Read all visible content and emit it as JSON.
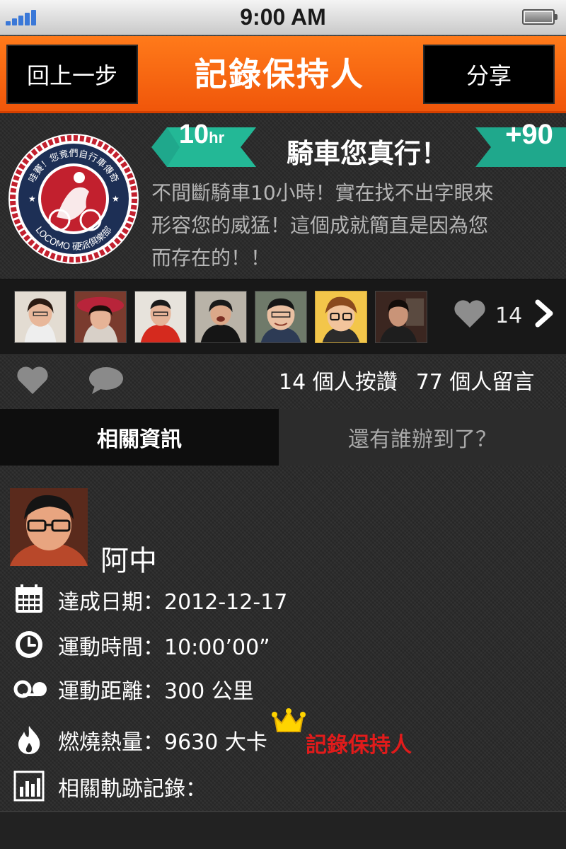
{
  "status_bar": {
    "time": "9:00 AM"
  },
  "header": {
    "back_label": "回上一步",
    "title": "記錄保持人",
    "share_label": "分享"
  },
  "achievement": {
    "badge_text_top": "哇賽！您竟們自行車傳奇",
    "badge_text_bottom": "LOCOMO 硬派俱樂部",
    "hours_value": "10",
    "hours_unit": "hr",
    "title": "騎車您真行！",
    "bonus": "+90",
    "description_lines": [
      "不間斷騎車10小時！實在找不出字眼來",
      "形容您的威猛！這個成就簡直是因為您",
      "而存在的！！"
    ]
  },
  "likers": {
    "count": "14",
    "avatars": [
      "avatar-1",
      "avatar-2",
      "avatar-3",
      "avatar-4",
      "avatar-5",
      "avatar-6",
      "avatar-7"
    ]
  },
  "actions": {
    "likes_text": "14 個人按讚",
    "comments_text": "77 個人留言"
  },
  "tabs": {
    "related_info": "相關資訊",
    "who_else": "還有誰辦到了？"
  },
  "details": {
    "user_name": "阿中",
    "date": "達成日期：2012-12-17",
    "time": "運動時間：10:00’00”",
    "distance": "運動距離：300 公里",
    "calories": "燃燒熱量：9630 大卡",
    "record_label": "記錄保持人",
    "tracks": "相關軌跡記錄："
  },
  "colors": {
    "header_orange": "#f0560a",
    "ribbon_teal": "#1fa88c",
    "record_red": "#e11b1b",
    "crown_yellow": "#ffd400"
  }
}
